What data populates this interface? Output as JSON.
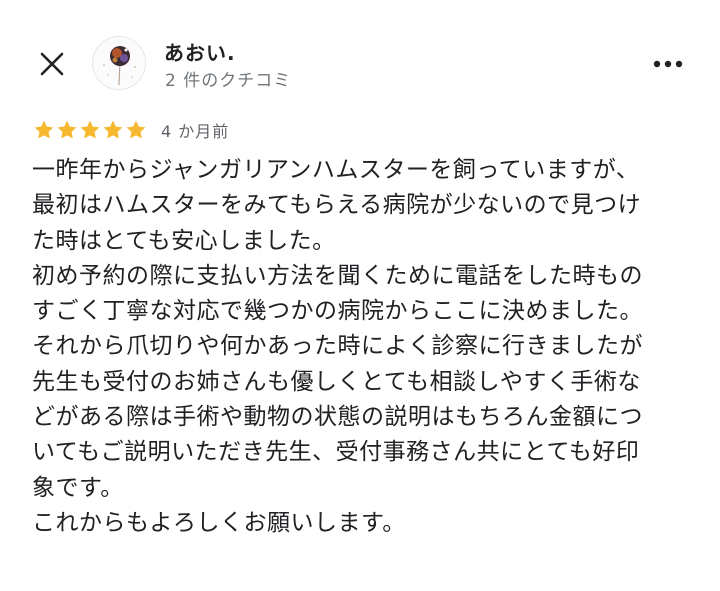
{
  "header": {
    "user_name": "あおい.",
    "review_count": "2 件のクチコミ"
  },
  "review": {
    "rating": 5,
    "rating_max": 5,
    "time": "4 か月前",
    "lines": [
      "一昨年からジャンガリアンハムスターを飼っていますが、",
      "最初はハムスターをみてもらえる病院が少ないので見つけ",
      "た時はとても安心しました。",
      "初め予約の際に支払い方法を聞くために電話をした時もの",
      "すごく丁寧な対応で幾つかの病院からここに決めました。",
      "それから爪切りや何かあった時によく診察に行きましたが",
      "先生も受付のお姉さんも優しくとても相談しやすく手術な",
      "どがある際は手術や動物の状態の説明はもちろん金額につ",
      "いてもご説明いただき先生、受付事務さん共にとても好印",
      "象です。",
      "これからもよろしくお願いします。"
    ]
  },
  "colors": {
    "star": "#f5b82e",
    "secondary_text": "#70757a",
    "primary_text": "#202124"
  },
  "icons": {
    "close": "close-icon",
    "more": "more-vert-icon",
    "star": "star-icon"
  }
}
